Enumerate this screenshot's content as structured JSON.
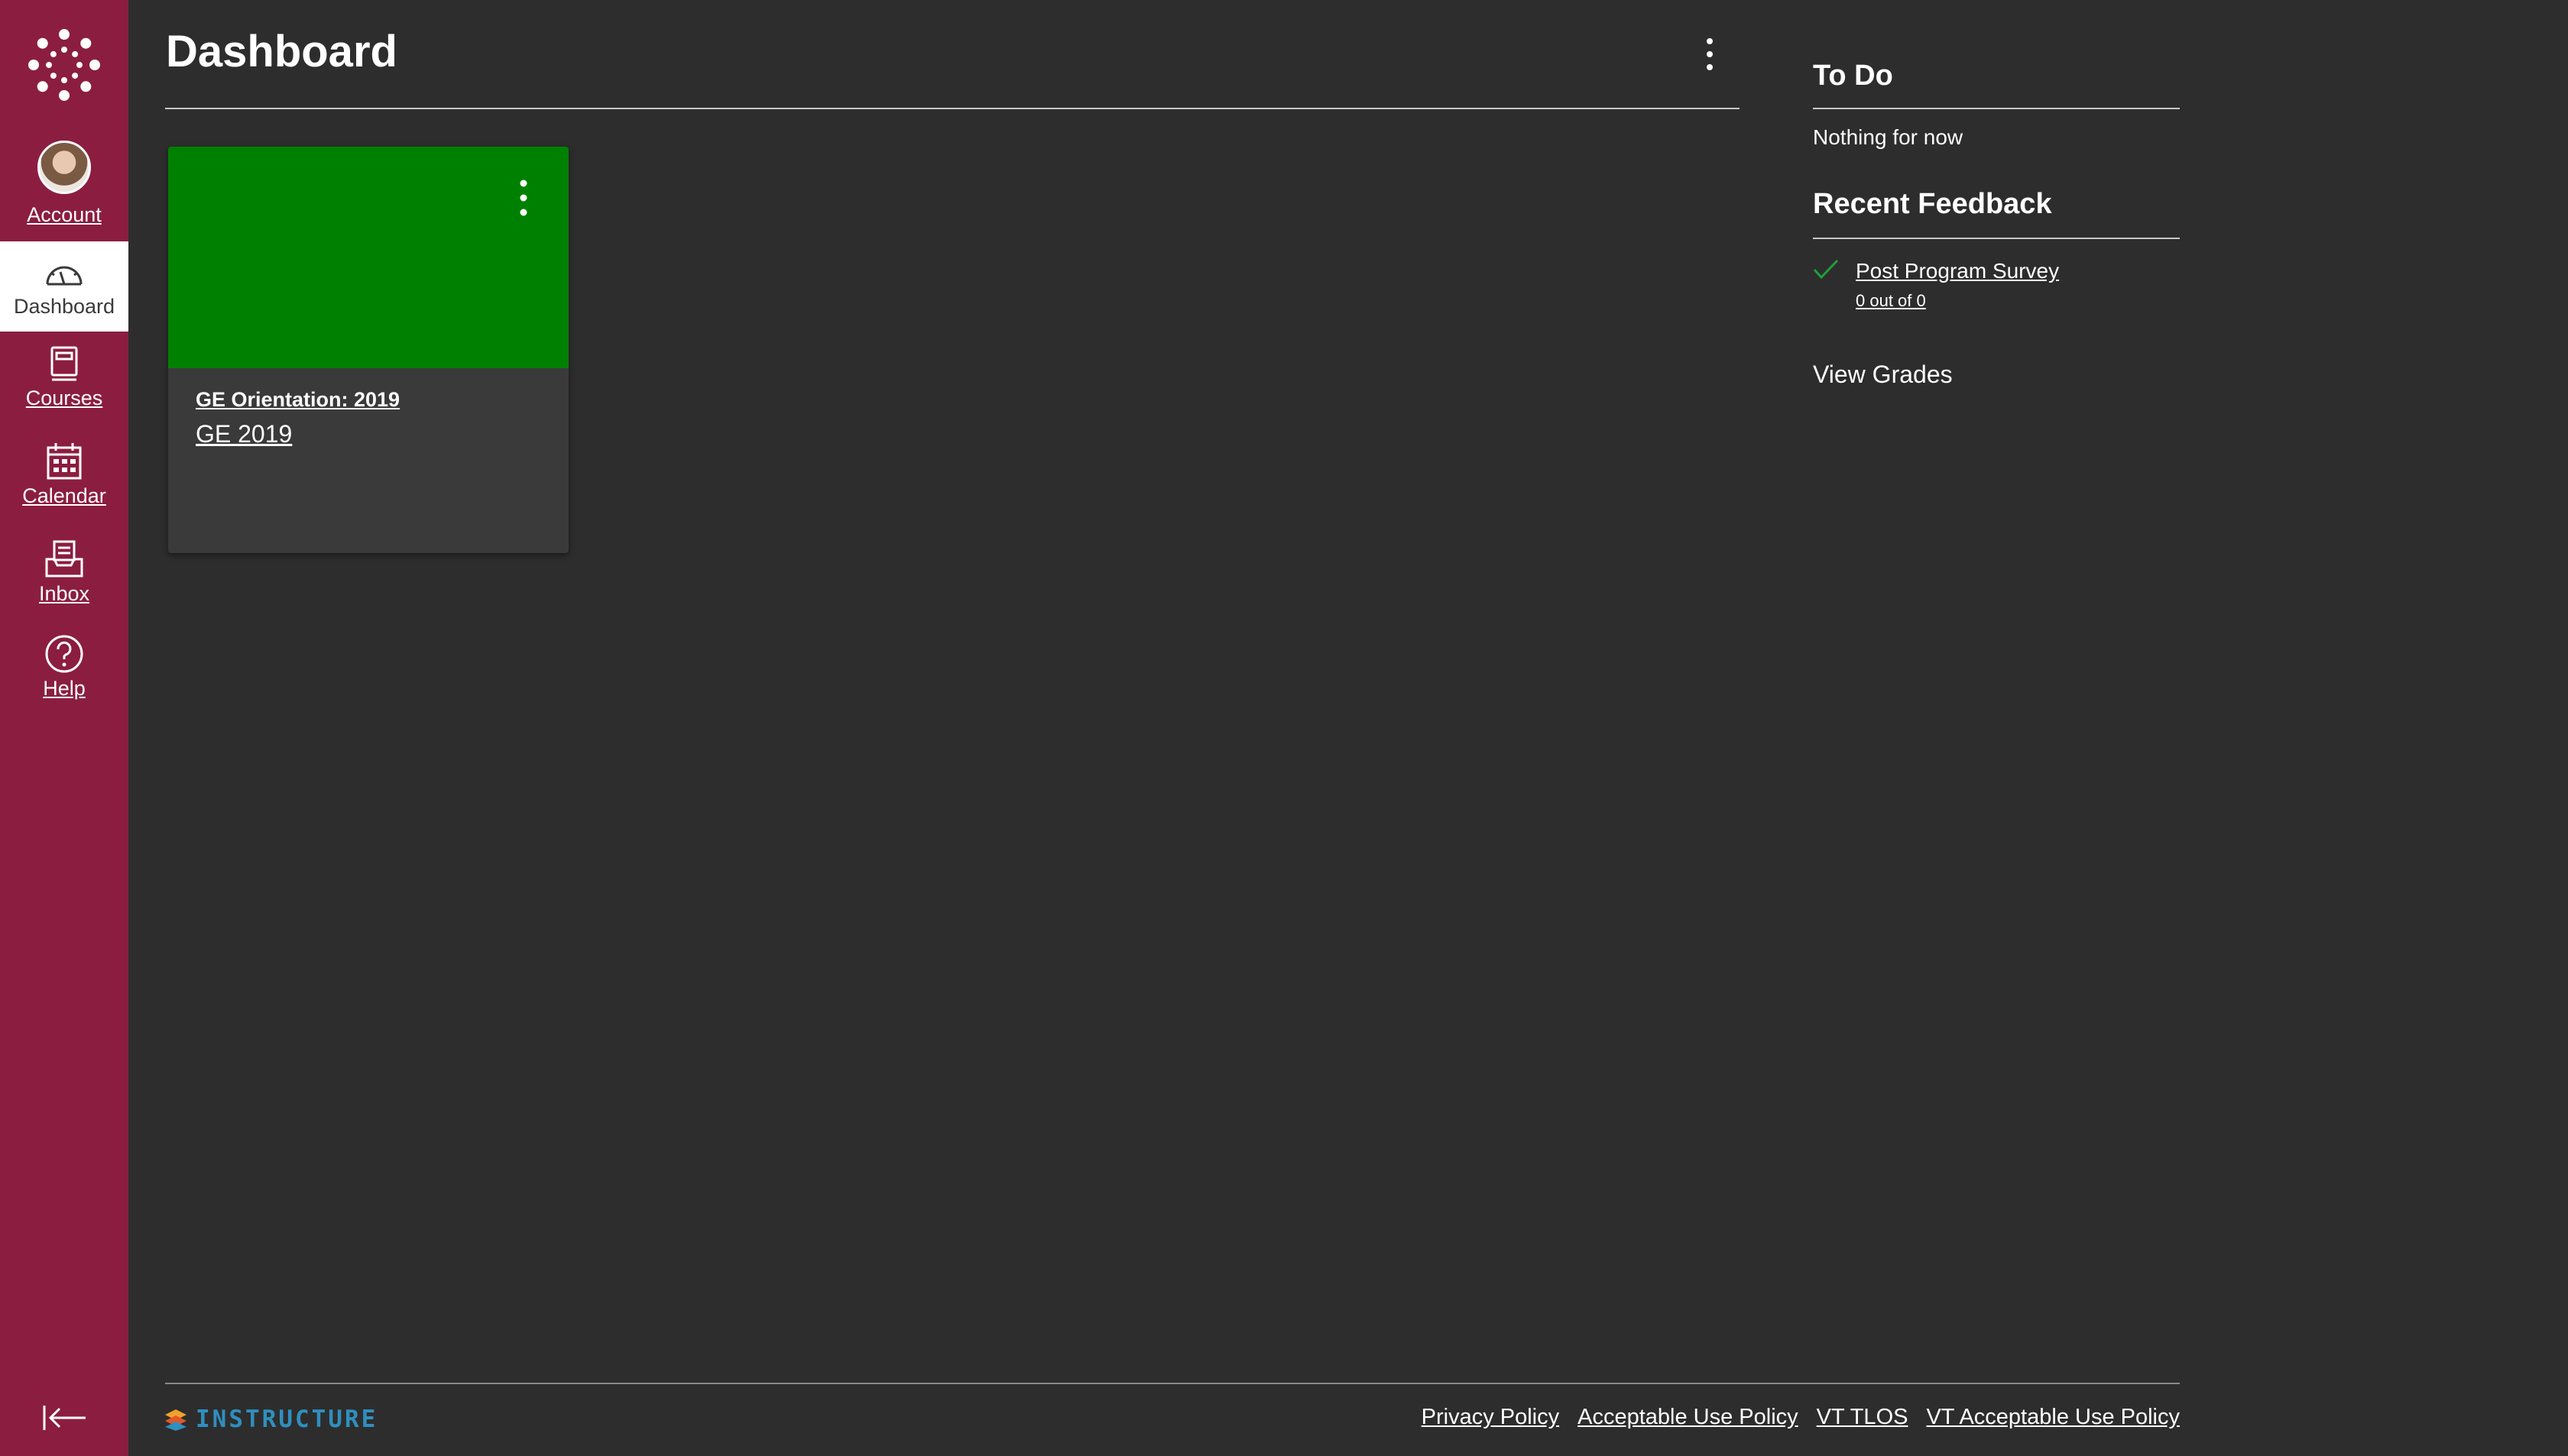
{
  "sidebar": {
    "items": [
      {
        "label": "Account"
      },
      {
        "label": "Dashboard"
      },
      {
        "label": "Courses"
      },
      {
        "label": "Calendar"
      },
      {
        "label": "Inbox"
      },
      {
        "label": "Help"
      }
    ],
    "active": "Dashboard",
    "color": "#8b1d41"
  },
  "header": {
    "title": "Dashboard"
  },
  "card": {
    "title": "GE Orientation: 2019",
    "subtitle": "GE 2019",
    "color": "#008000"
  },
  "todo": {
    "heading": "To Do",
    "empty_text": "Nothing for now"
  },
  "feedback": {
    "heading": "Recent Feedback",
    "items": [
      {
        "title": "Post Program Survey",
        "score": "0 out of 0"
      }
    ],
    "view_grades": "View Grades"
  },
  "footer": {
    "brand": "INSTRUCTURE",
    "links": [
      "Privacy Policy",
      "Acceptable Use Policy",
      "VT TLOS",
      "VT Acceptable Use Policy"
    ]
  }
}
